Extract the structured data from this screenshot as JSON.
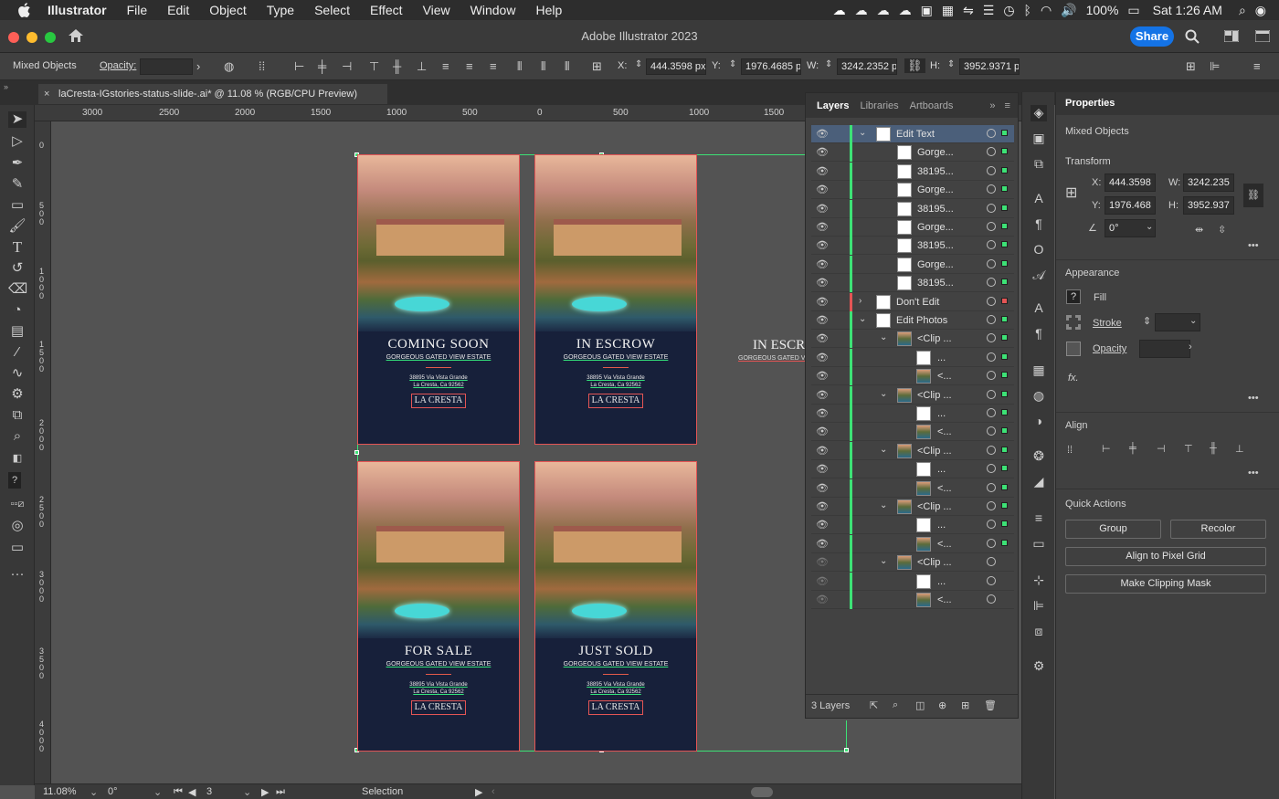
{
  "menubar": {
    "app": "Illustrator",
    "items": [
      "File",
      "Edit",
      "Object",
      "Type",
      "Select",
      "Effect",
      "View",
      "Window",
      "Help"
    ],
    "battery": "100%",
    "clock": "Sat 1:26 AM"
  },
  "titlebar": {
    "title": "Adobe Illustrator 2023",
    "share": "Share"
  },
  "control": {
    "selection": "Mixed Objects",
    "opacity_label": "Opacity:",
    "x_label": "X:",
    "x": "444.3598 px",
    "y_label": "Y:",
    "y": "1976.4685 px",
    "w_label": "W:",
    "w": "3242.2352 px",
    "h_label": "H:",
    "h": "3952.9371 px"
  },
  "document": {
    "tab": "laCresta-IGstories-status-slide-.ai* @ 11.08 % (RGB/CPU Preview)"
  },
  "ruler": {
    "h_ticks": [
      "3000",
      "2500",
      "2000",
      "1500",
      "1000",
      "500",
      "0",
      "500",
      "1000",
      "1500"
    ],
    "v_ticks": [
      "0",
      "500",
      "1000",
      "1500",
      "2000",
      "2500",
      "3000",
      "3500",
      "4000"
    ]
  },
  "slides": [
    {
      "title": "COMING SOON",
      "subtitle": "GORGEOUS GATED VIEW ESTATE",
      "addr1": "38895 Via Vista Grande",
      "addr2": "La Cresta, Ca 92562",
      "logo": "LA CRESTA"
    },
    {
      "title": "IN ESCROW",
      "subtitle": "GORGEOUS GATED VIEW ESTATE",
      "addr1": "38895 Via Vista Grande",
      "addr2": "La Cresta, Ca 92562",
      "logo": "LA CRESTA"
    },
    {
      "title": "FOR SALE",
      "subtitle": "GORGEOUS GATED VIEW ESTATE",
      "addr1": "38895 Via Vista Grande",
      "addr2": "La Cresta, Ca 92562",
      "logo": "LA CRESTA"
    },
    {
      "title": "JUST SOLD",
      "subtitle": "GORGEOUS GATED VIEW ESTATE",
      "addr1": "38895 Via Vista Grande",
      "addr2": "La Cresta, Ca 92562",
      "logo": "LA CRESTA"
    }
  ],
  "stray": {
    "title": "IN ESCR",
    "subtitle": "GORGEOUS GATED V"
  },
  "layers": {
    "tabs": [
      "Layers",
      "Libraries",
      "Artboards"
    ],
    "rows": [
      "Edit Text",
      "Gorge...",
      "38195...",
      "Gorge...",
      "38195...",
      "Gorge...",
      "38195...",
      "Gorge...",
      "38195...",
      "Don't Edit",
      "Edit Photos",
      "<Clip ...",
      "...",
      "<...",
      "<Clip ...",
      "...",
      "<...",
      "<Clip ...",
      "...",
      "<...",
      "<Clip ...",
      "...",
      "<...",
      "<Clip ...",
      "...",
      "<..."
    ],
    "count": "3 Layers"
  },
  "properties": {
    "title": "Properties",
    "selection": "Mixed Objects",
    "transform": "Transform",
    "x_label": "X:",
    "x": "444.3598",
    "y_label": "Y:",
    "y": "1976.468",
    "w_label": "W:",
    "w": "3242.235",
    "h_label": "H:",
    "h": "3952.937",
    "angle": "0°",
    "appearance": "Appearance",
    "fill": "Fill",
    "stroke": "Stroke",
    "opacity": "Opacity",
    "fx": "fx.",
    "align": "Align",
    "quick": "Quick Actions",
    "btn_group": "Group",
    "btn_recolor": "Recolor",
    "btn_align_pixel": "Align to Pixel Grid",
    "btn_clip": "Make Clipping Mask"
  },
  "status": {
    "zoom": "11.08%",
    "rotate": "0°",
    "artboard": "3",
    "tool": "Selection"
  },
  "colors": {
    "accent": "#1473e6",
    "layer_green": "#3de276",
    "slide_bg": "#17203a",
    "guide_red": "#e45555"
  }
}
